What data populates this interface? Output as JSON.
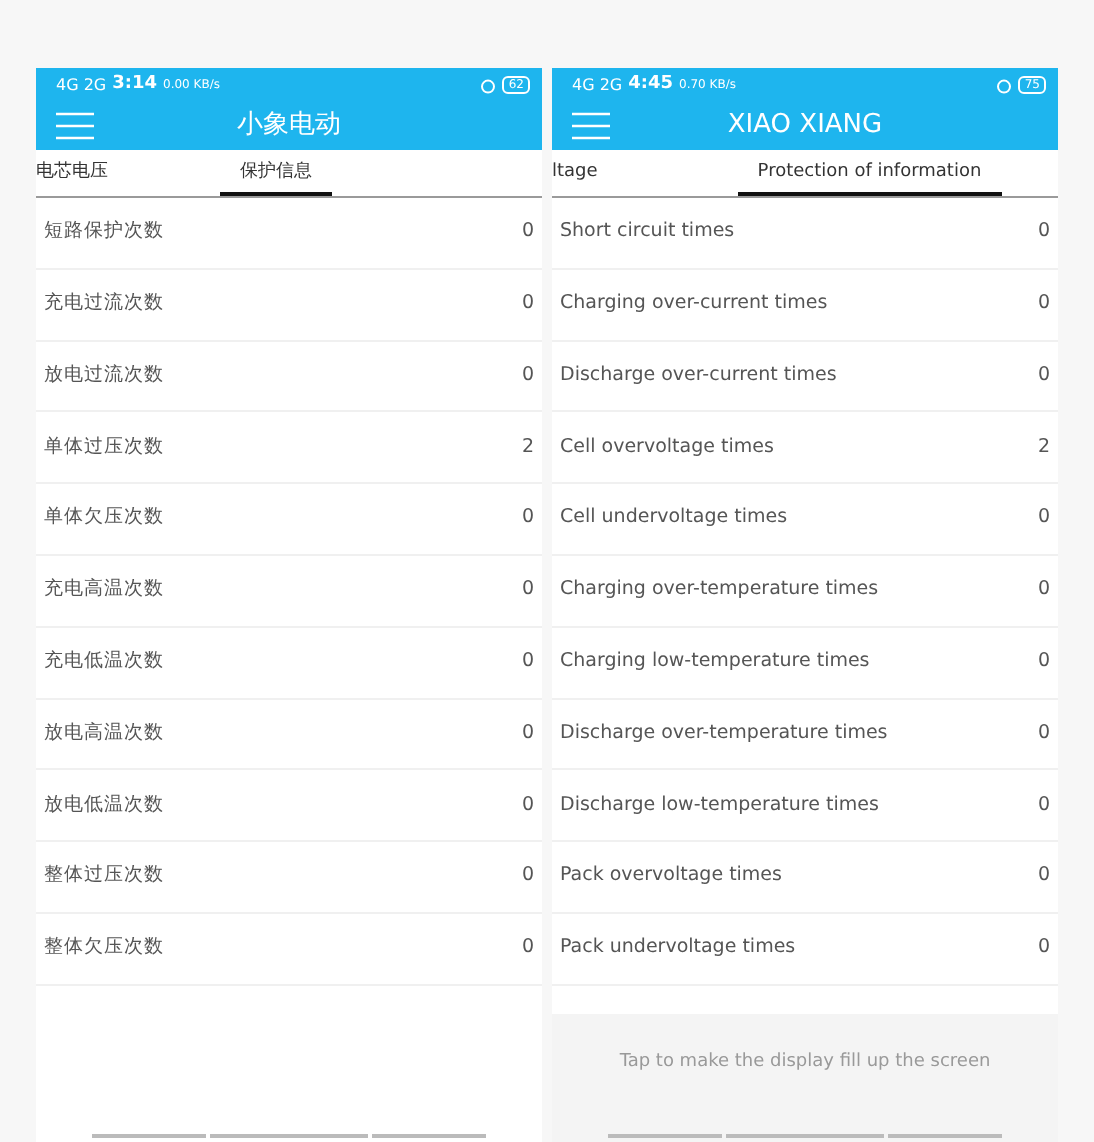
{
  "phones": [
    {
      "status_bar": {
        "network": "4G 2G",
        "time": "3:14",
        "speed": "0.00",
        "speed_unit": "KB/s",
        "battery": "62"
      },
      "app_bar": {
        "title": "小象电动"
      },
      "tabs": [
        {
          "label": "电芯电压",
          "selected": false
        },
        {
          "label": "保护信息",
          "selected": true
        }
      ],
      "rows": [
        {
          "label": "短路保护次数",
          "value": "0"
        },
        {
          "label": "充电过流次数",
          "value": "0"
        },
        {
          "label": "放电过流次数",
          "value": "0"
        },
        {
          "label": "单体过压次数",
          "value": "2"
        },
        {
          "label": "单体欠压次数",
          "value": "0"
        },
        {
          "label": "充电高温次数",
          "value": "0"
        },
        {
          "label": "充电低温次数",
          "value": "0"
        },
        {
          "label": "放电高温次数",
          "value": "0"
        },
        {
          "label": "放电低温次数",
          "value": "0"
        },
        {
          "label": "整体过压次数",
          "value": "0"
        },
        {
          "label": "整体欠压次数",
          "value": "0"
        }
      ]
    },
    {
      "status_bar": {
        "network": "4G 2G",
        "time": "4:45",
        "speed": "0.70",
        "speed_unit": "KB/s",
        "battery": "75"
      },
      "app_bar": {
        "title": "XIAO XIANG"
      },
      "tabs": [
        {
          "label": "ltage",
          "selected": false
        },
        {
          "label": "Protection of information",
          "selected": true
        }
      ],
      "rows": [
        {
          "label": "Short circuit times",
          "value": "0"
        },
        {
          "label": "Charging over-current times",
          "value": "0"
        },
        {
          "label": "Discharge over-current times",
          "value": "0"
        },
        {
          "label": "Cell overvoltage times",
          "value": "2"
        },
        {
          "label": "Cell undervoltage times",
          "value": "0"
        },
        {
          "label": "Charging over-temperature times",
          "value": "0"
        },
        {
          "label": "Charging low-temperature times",
          "value": "0"
        },
        {
          "label": "Discharge over-temperature times",
          "value": "0"
        },
        {
          "label": "Discharge low-temperature times",
          "value": "0"
        },
        {
          "label": "Pack overvoltage times",
          "value": "0"
        },
        {
          "label": "Pack undervoltage times",
          "value": "0"
        }
      ],
      "footer_hint": "Tap to make the display fill up the screen"
    }
  ]
}
